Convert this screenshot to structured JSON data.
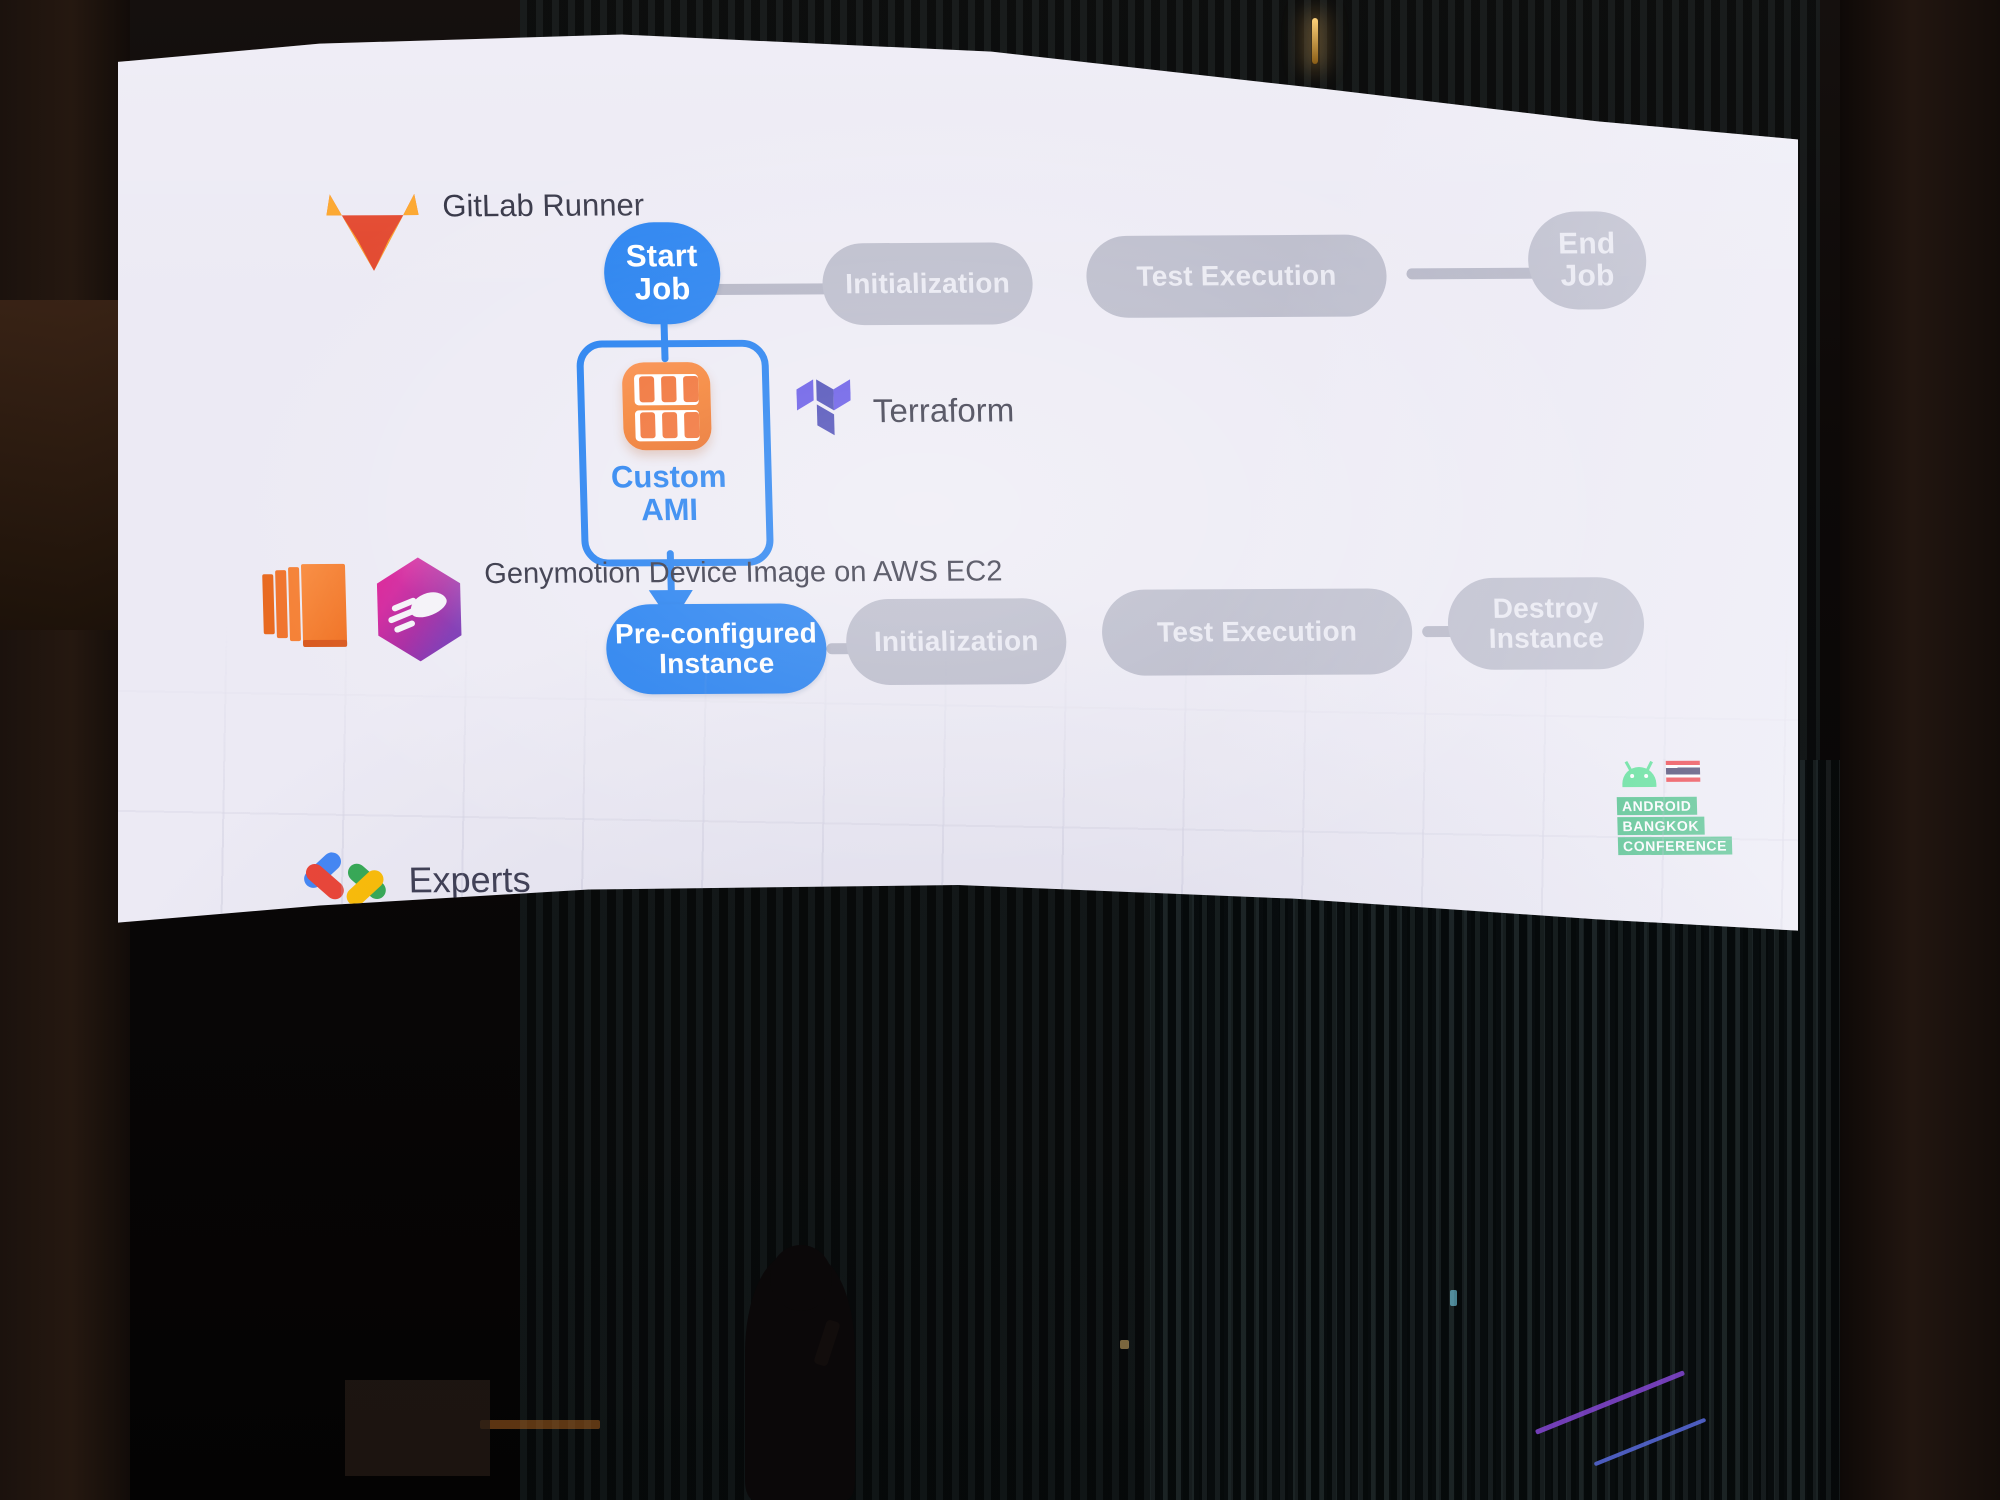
{
  "scene": {
    "kind": "conference-slide-photo",
    "venue_lighting": "dark auditorium, bright LED wall"
  },
  "slide": {
    "title_text": "",
    "colors": {
      "accent_blue": "#1a7aef",
      "pill_grey": "#b8b9c9",
      "pill_grey_text": "#e9e9f2",
      "slide_background": "#eceaf4",
      "label_text": "#2a2a3c",
      "aws_orange": "#f0692a",
      "terraform_purple": "#5c4ee5",
      "genymotion_magenta": "#e0198f",
      "genymotion_purple": "#6a34b4",
      "gitlab_orange": "#e24329",
      "android_green": "#3ddc84",
      "conference_green": "#2bb673"
    },
    "labels": {
      "gitlab_runner": "GitLab\nRunner",
      "gitlab_runner_line1": "GitLab",
      "gitlab_runner_line2": "Runner",
      "terraform": "Terraform",
      "genymotion_line1": "Genymotion",
      "genymotion_line2": "Device Image",
      "genymotion_line3": "on AWS EC2",
      "custom_ami_line1": "Custom",
      "custom_ami_line2": "AMI"
    },
    "pipelines": [
      {
        "id": "gitlab-runner-pipeline",
        "row": "top",
        "nodes": [
          {
            "label_line1": "Start",
            "label_line2": "Job",
            "style": "blue",
            "shape": "circle"
          },
          {
            "label_line1": "Initialization",
            "label_line2": "",
            "style": "grey",
            "shape": "pill"
          },
          {
            "label_line1": "Test Execution",
            "label_line2": "",
            "style": "grey",
            "shape": "pill"
          },
          {
            "label_line1": "End",
            "label_line2": "Job",
            "style": "grey",
            "shape": "circle"
          }
        ]
      },
      {
        "id": "ec2-instance-pipeline",
        "row": "bottom",
        "nodes": [
          {
            "label_line1": "Pre-configured",
            "label_line2": "Instance",
            "style": "blue",
            "shape": "pill"
          },
          {
            "label_line1": "Initialization",
            "label_line2": "",
            "style": "grey",
            "shape": "pill"
          },
          {
            "label_line1": "Test Execution",
            "label_line2": "",
            "style": "grey",
            "shape": "pill"
          },
          {
            "label_line1": "Destroy",
            "label_line2": "Instance",
            "style": "grey",
            "shape": "pill"
          }
        ]
      }
    ],
    "icons": {
      "gitlab": "gitlab-tanuki-icon",
      "terraform": "terraform-icon",
      "aws_ec2": "aws-ec2-icon",
      "genymotion": "genymotion-hexagon-icon",
      "custom_ami": "aws-ami-icon",
      "flow_arrow": "arrow-down-icon"
    },
    "footer": {
      "experts_label": "Experts",
      "experts_mark": "google-developer-experts-icon",
      "conference_badge": {
        "line1": "ANDROID",
        "line2": "BANGKOK",
        "line3": "CONFERENCE",
        "mascot": "android-robot-icon",
        "flag": "thailand-flag-icon"
      }
    }
  }
}
